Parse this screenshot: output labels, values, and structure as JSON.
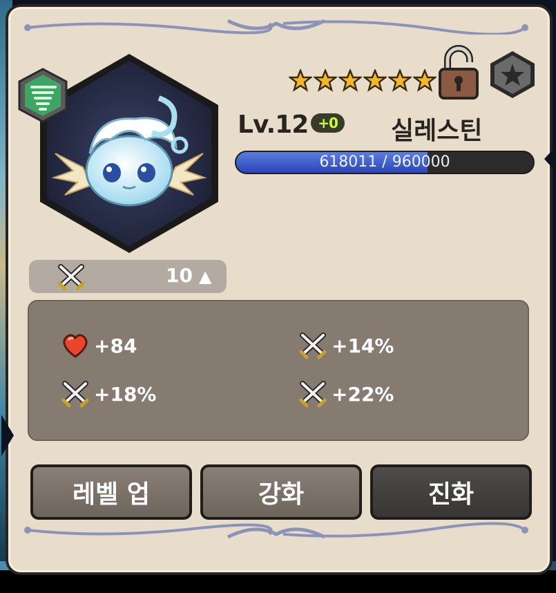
{
  "card": {
    "level_prefix": "Lv.",
    "level": "12",
    "level_bonus": "+0",
    "name": "실레스틴",
    "stars": 6,
    "xp_current": 618011,
    "xp_max": 960000,
    "xp_text": "618011 / 960000",
    "lock_state": "unlocked",
    "element_icon": "wind-element-icon",
    "portrait_icon": "cloud-spirit-pet-portrait"
  },
  "power": {
    "icon": "crossed-swords-icon",
    "value": "10",
    "arrow": "▲"
  },
  "stats": [
    {
      "icon": "heart-icon",
      "value": "+84"
    },
    {
      "icon": "crossed-swords-icon",
      "value": "+14%"
    },
    {
      "icon": "crossed-swords-icon",
      "value": "+18%"
    },
    {
      "icon": "crossed-swords-icon",
      "value": "+22%"
    }
  ],
  "buttons": {
    "level_up": "레벨 업",
    "enhance": "강화",
    "evolve": "진화"
  },
  "colors": {
    "panel": "#e8ddca",
    "xp_fill": "#3b56c8",
    "star": "#f5b72a",
    "level_bonus": "#c8ff3a"
  }
}
